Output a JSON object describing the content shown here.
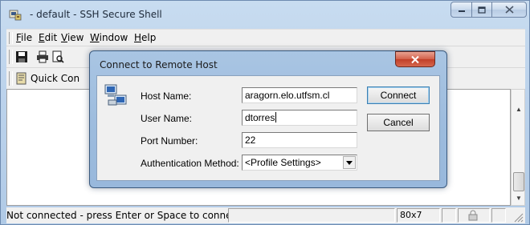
{
  "window": {
    "title": " - default - SSH Secure Shell",
    "icons": {
      "app": "ssh-app-icon",
      "minimize": "minimize-icon",
      "maximize": "maximize-icon",
      "close": "close-icon"
    }
  },
  "menu": {
    "items": [
      {
        "label": "File"
      },
      {
        "label": "Edit"
      },
      {
        "label": "View"
      },
      {
        "label": "Window"
      },
      {
        "label": "Help"
      }
    ]
  },
  "toolbar": {
    "quick_connect_label": "Quick Con",
    "icons": [
      "save-icon",
      "print-icon",
      "print-preview-icon"
    ]
  },
  "dialog": {
    "title": "Connect to Remote Host",
    "host_name_label": "Host Name:",
    "host_name_value": "aragorn.elo.utfsm.cl",
    "user_name_label": "User Name:",
    "user_name_value": "dtorres",
    "port_label": "Port Number:",
    "port_value": "22",
    "auth_label": "Authentication Method:",
    "auth_value": "<Profile Settings>",
    "connect_button": "Connect",
    "cancel_button": "Cancel"
  },
  "status": {
    "message": "Not connected - press Enter or Space to conne",
    "size": "80x7"
  },
  "colors": {
    "frame": "#b0cae6",
    "dialog_frame": "#9cbbdd",
    "close_button": "#c13f28"
  }
}
